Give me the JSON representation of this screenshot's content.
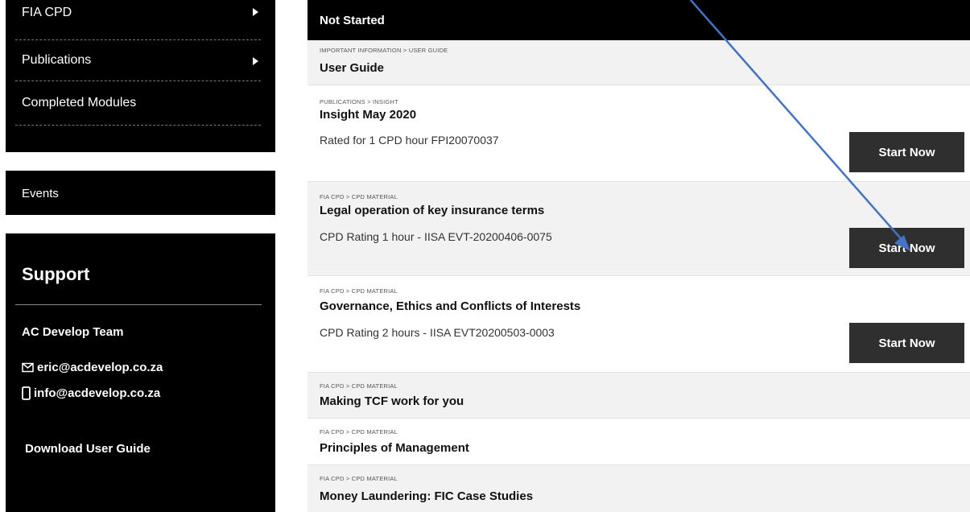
{
  "sidebar": {
    "menu": [
      {
        "label": "FIA CPD",
        "has_submenu": true
      },
      {
        "label": "Publications",
        "has_submenu": true
      },
      {
        "label": "Completed Modules",
        "has_submenu": false
      }
    ],
    "events_label": "Events",
    "support": {
      "title": "Support",
      "team": "AC Develop Team",
      "email": "eric@acdevelop.co.za",
      "phone_contact": "info@acdevelop.co.za",
      "download_label": "Download User Guide"
    }
  },
  "main": {
    "header": "Not Started",
    "items": [
      {
        "crumb": "IMPORTANT INFORMATION > USER GUIDE",
        "title": "User Guide",
        "desc": "",
        "button": ""
      },
      {
        "crumb": "PUBLICATIONS > INSIGHT",
        "title": "Insight May 2020",
        "desc": "Rated for 1 CPD hour FPI20070037",
        "button": "Start Now"
      },
      {
        "crumb": "FIA CPD > CPD MATERIAL",
        "title": "Legal operation of key insurance terms",
        "desc": "CPD Rating 1 hour - IISA EVT-20200406-0075",
        "button": "Start Now"
      },
      {
        "crumb": "FIA CPD > CPD MATERIAL",
        "title": "Governance, Ethics and Conflicts of Interests",
        "desc": "CPD Rating 2 hours - IISA EVT20200503-0003",
        "button": "Start Now"
      },
      {
        "crumb": "FIA CPD > CPD MATERIAL",
        "title": "Making TCF work for you",
        "desc": "",
        "button": ""
      },
      {
        "crumb": "FIA CPD > CPD MATERIAL",
        "title": "Principles of Management",
        "desc": "",
        "button": ""
      },
      {
        "crumb": "FIA CPD > CPD MATERIAL",
        "title": "Money Laundering: FIC Case Studies",
        "desc": "",
        "button": ""
      }
    ]
  },
  "colors": {
    "annotation_arrow": "#4472c4",
    "button_bg": "#2f2f2f",
    "row_alt_bg": "#f2f2f2"
  }
}
